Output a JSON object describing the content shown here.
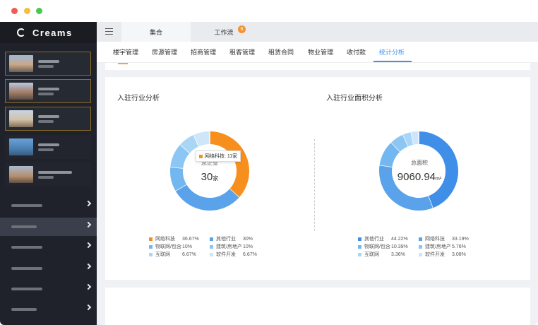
{
  "brand": {
    "name": "Creams"
  },
  "sidebar": {
    "projects": [
      {
        "name": "",
        "active": true
      },
      {
        "name": "",
        "active": true
      },
      {
        "name": "",
        "active": true
      },
      {
        "name": "",
        "active": false
      },
      {
        "name": "",
        "active": false
      }
    ],
    "menu": [
      {
        "label": "",
        "active": false
      },
      {
        "label": "",
        "active": true
      },
      {
        "label": "",
        "active": false
      },
      {
        "label": "",
        "active": false
      },
      {
        "label": "",
        "active": false
      },
      {
        "label": "",
        "active": false
      }
    ]
  },
  "topbar": {
    "tabs": [
      {
        "label": "集合",
        "active": true
      },
      {
        "label": "工作流",
        "active": false,
        "badge": "6"
      }
    ]
  },
  "subnav": {
    "items": [
      "楼宇管理",
      "房源管理",
      "招商管理",
      "租客管理",
      "租赁合同",
      "物业管理",
      "收付款",
      "统计分析"
    ],
    "active_index": 7
  },
  "industry_panel": {
    "title": "入驻行业分析",
    "center_label": "总企业",
    "center_value": "30",
    "center_unit": "家",
    "tooltip": "网络科技: 11家",
    "legend": [
      {
        "name": "网络科技",
        "pct": "36.67%",
        "color": "#f78f1e"
      },
      {
        "name": "其他行业",
        "pct": "30%",
        "color": "#5aa2ea"
      },
      {
        "name": "物联网/包含",
        "pct": "10%",
        "color": "#73b7f0"
      },
      {
        "name": "建筑/房地产",
        "pct": "10%",
        "color": "#8cc6f4"
      },
      {
        "name": "互联网",
        "pct": "6.67%",
        "color": "#a9d5f7"
      },
      {
        "name": "软件开发",
        "pct": "6.67%",
        "color": "#cde6fa"
      }
    ]
  },
  "area_panel": {
    "title": "入驻行业面积分析",
    "center_label": "总面积",
    "center_value": "9060.94",
    "center_unit": "m²",
    "legend": [
      {
        "name": "其他行业",
        "pct": "44.22%",
        "color": "#3f8fe8"
      },
      {
        "name": "网络科技",
        "pct": "33.19%",
        "color": "#5aa2ea"
      },
      {
        "name": "物联网/包含",
        "pct": "10.39%",
        "color": "#73b7f0"
      },
      {
        "name": "建筑/房地产",
        "pct": "5.76%",
        "color": "#8cc6f4"
      },
      {
        "name": "互联网",
        "pct": "3.36%",
        "color": "#a9d5f7"
      },
      {
        "name": "软件开发",
        "pct": "3.08%",
        "color": "#cde6fa"
      }
    ]
  },
  "chart_data": [
    {
      "type": "pie",
      "title": "入驻行业分析",
      "categories": [
        "网络科技",
        "其他行业",
        "物联网/包含",
        "建筑/房地产",
        "互联网",
        "软件开发"
      ],
      "values": [
        36.67,
        30,
        10,
        10,
        6.67,
        6.67
      ]
    },
    {
      "type": "pie",
      "title": "入驻行业面积分析",
      "categories": [
        "其他行业",
        "网络科技",
        "物联网/包含",
        "建筑/房地产",
        "互联网",
        "软件开发"
      ],
      "values": [
        44.22,
        33.19,
        10.39,
        5.76,
        3.36,
        3.08
      ]
    }
  ]
}
